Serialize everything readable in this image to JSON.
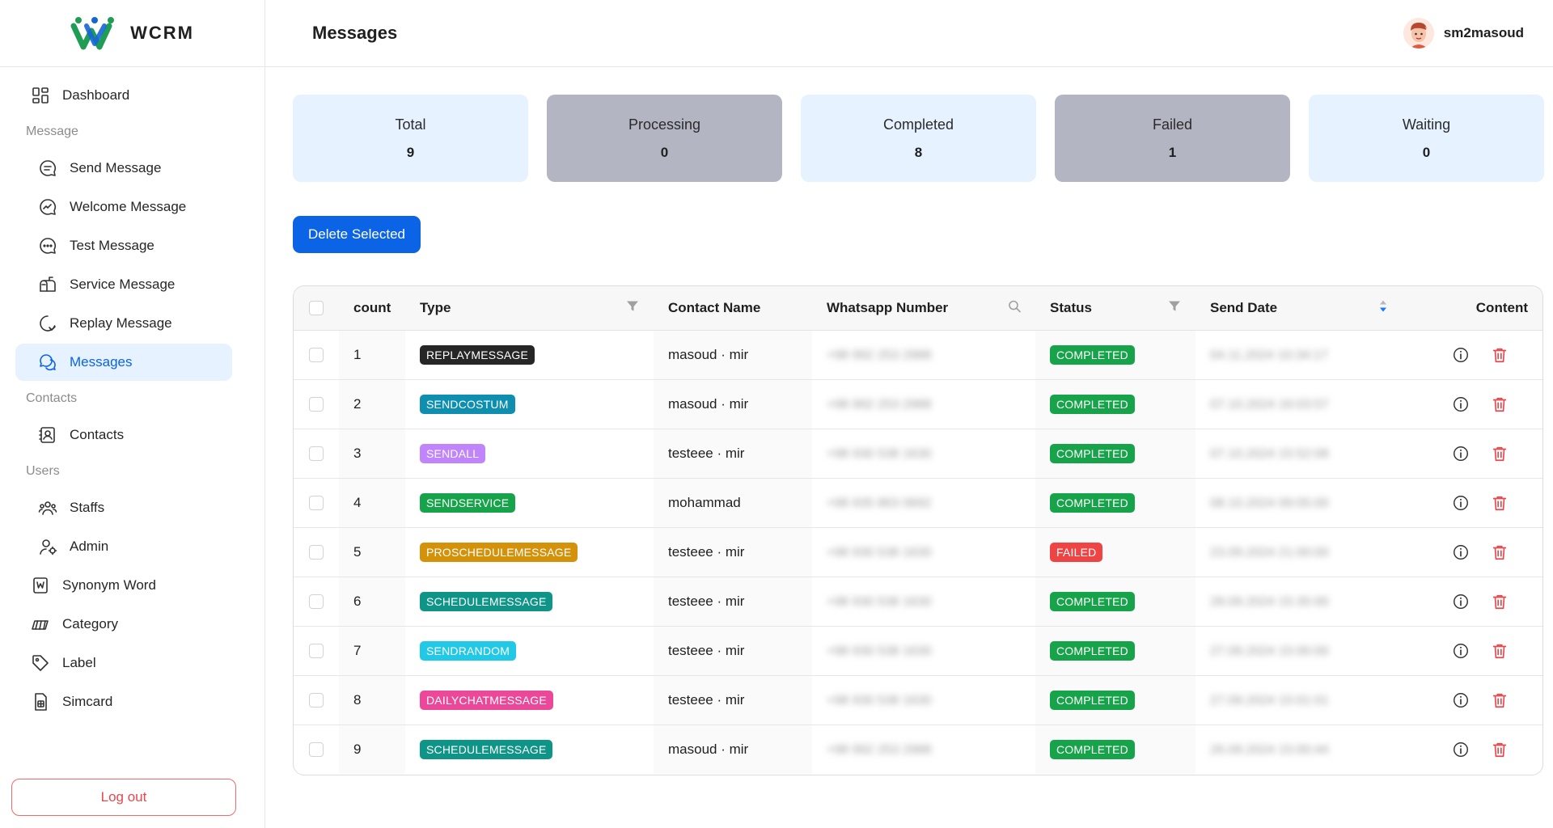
{
  "brand": {
    "name": "WCRM",
    "colors": {
      "green": "#1f9d55",
      "blue": "#1565d8"
    }
  },
  "header": {
    "title": "Messages",
    "username": "sm2masoud"
  },
  "sidebar": {
    "items": [
      {
        "label": "Dashboard",
        "icon": "dashboard-icon",
        "type": "item"
      },
      {
        "label": "Message",
        "type": "group"
      },
      {
        "label": "Send Message",
        "icon": "chat-lines-icon",
        "type": "sub"
      },
      {
        "label": "Welcome Message",
        "icon": "chat-wave-icon",
        "type": "sub"
      },
      {
        "label": "Test Message",
        "icon": "chat-dots-icon",
        "type": "sub"
      },
      {
        "label": "Service Message",
        "icon": "mailbox-icon",
        "type": "sub"
      },
      {
        "label": "Replay Message",
        "icon": "chat-reply-icon",
        "type": "sub"
      },
      {
        "label": "Messages",
        "icon": "chats-icon",
        "type": "sub",
        "active": true
      },
      {
        "label": "Contacts",
        "type": "group"
      },
      {
        "label": "Contacts",
        "icon": "contact-card-icon",
        "type": "sub"
      },
      {
        "label": "Users",
        "type": "group"
      },
      {
        "label": "Staffs",
        "icon": "team-icon",
        "type": "sub"
      },
      {
        "label": "Admin",
        "icon": "admin-icon",
        "type": "sub"
      },
      {
        "label": "Synonym Word",
        "icon": "word-doc-icon",
        "type": "item"
      },
      {
        "label": "Category",
        "icon": "category-icon",
        "type": "item"
      },
      {
        "label": "Label",
        "icon": "tag-icon",
        "type": "item"
      },
      {
        "label": "Simcard",
        "icon": "simcard-icon",
        "type": "item"
      }
    ],
    "logout_label": "Log out"
  },
  "stats": [
    {
      "label": "Total",
      "value": "9",
      "tone": "light"
    },
    {
      "label": "Processing",
      "value": "0",
      "tone": "gray"
    },
    {
      "label": "Completed",
      "value": "8",
      "tone": "light"
    },
    {
      "label": "Failed",
      "value": "1",
      "tone": "gray"
    },
    {
      "label": "Waiting",
      "value": "0",
      "tone": "light"
    }
  ],
  "toolbar": {
    "delete_label": "Delete Selected"
  },
  "table": {
    "columns": [
      "count",
      "Type",
      "Contact Name",
      "Whatsapp Number",
      "Status",
      "Send Date",
      "Content"
    ],
    "rows": [
      {
        "count": "1",
        "type": "REPLAYMESSAGE",
        "type_color": "#262626",
        "contact": "masoud · mir",
        "phone": "+98 992 253 2988",
        "status": "COMPLETED",
        "date": "04.11.2024 10:34:17"
      },
      {
        "count": "2",
        "type": "SENDCOSTUM",
        "type_color": "#0e8fb0",
        "contact": "masoud · mir",
        "phone": "+98 992 253 2988",
        "status": "COMPLETED",
        "date": "07.10.2024 16:03:57"
      },
      {
        "count": "3",
        "type": "SENDALL",
        "type_color": "#c084fc",
        "contact": "testeee · mir",
        "phone": "+98 930 538 1630",
        "status": "COMPLETED",
        "date": "07.10.2024 15:52:08"
      },
      {
        "count": "4",
        "type": "SENDSERVICE",
        "type_color": "#16a34a",
        "contact": "mohammad",
        "phone": "+98 935 863 0692",
        "status": "COMPLETED",
        "date": "08.10.2024 09:05:00"
      },
      {
        "count": "5",
        "type": "PROSCHEDULEMESSAGE",
        "type_color": "#d4920b",
        "contact": "testeee · mir",
        "phone": "+98 930 538 1630",
        "status": "FAILED",
        "date": "23.09.2024 21:00:00"
      },
      {
        "count": "6",
        "type": "SCHEDULEMESSAGE",
        "type_color": "#0f9488",
        "contact": "testeee · mir",
        "phone": "+98 930 538 1630",
        "status": "COMPLETED",
        "date": "28.09.2024 15:35:00"
      },
      {
        "count": "7",
        "type": "SENDRANDOM",
        "type_color": "#22c9e6",
        "contact": "testeee · mir",
        "phone": "+98 930 538 1630",
        "status": "COMPLETED",
        "date": "27.09.2024 15:00:00"
      },
      {
        "count": "8",
        "type": "DAILYCHATMESSAGE",
        "type_color": "#ec4899",
        "contact": "testeee · mir",
        "phone": "+98 930 538 1630",
        "status": "COMPLETED",
        "date": "27.09.2024 15:01:01"
      },
      {
        "count": "9",
        "type": "SCHEDULEMESSAGE",
        "type_color": "#0f9488",
        "contact": "masoud · mir",
        "phone": "+98 992 253 2988",
        "status": "COMPLETED",
        "date": "26.09.2024 15:00:44"
      }
    ],
    "status_colors": {
      "COMPLETED": "#16a34a",
      "FAILED": "#ef4444"
    }
  }
}
